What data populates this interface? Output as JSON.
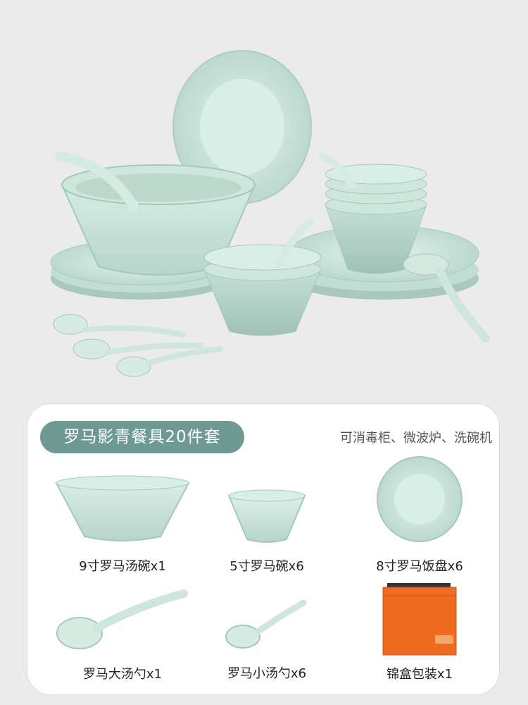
{
  "product": {
    "title": "罗马影青餐具20件套",
    "features": "可消毒柜、微波炉、洗碗机",
    "accent_color": "#6f9a93",
    "glaze_color": "#cfe6dc"
  },
  "items": [
    {
      "label": "9寸罗马汤碗x1",
      "icon": "soup-bowl-icon"
    },
    {
      "label": "5寸罗马碗x6",
      "icon": "bowl-icon"
    },
    {
      "label": "8寸罗马饭盘x6",
      "icon": "plate-icon"
    },
    {
      "label": "罗马大汤勺x1",
      "icon": "large-spoon-icon"
    },
    {
      "label": "罗马小汤勺x6",
      "icon": "small-spoon-icon"
    },
    {
      "label": "锦盒包装x1",
      "icon": "gift-box-icon"
    }
  ]
}
